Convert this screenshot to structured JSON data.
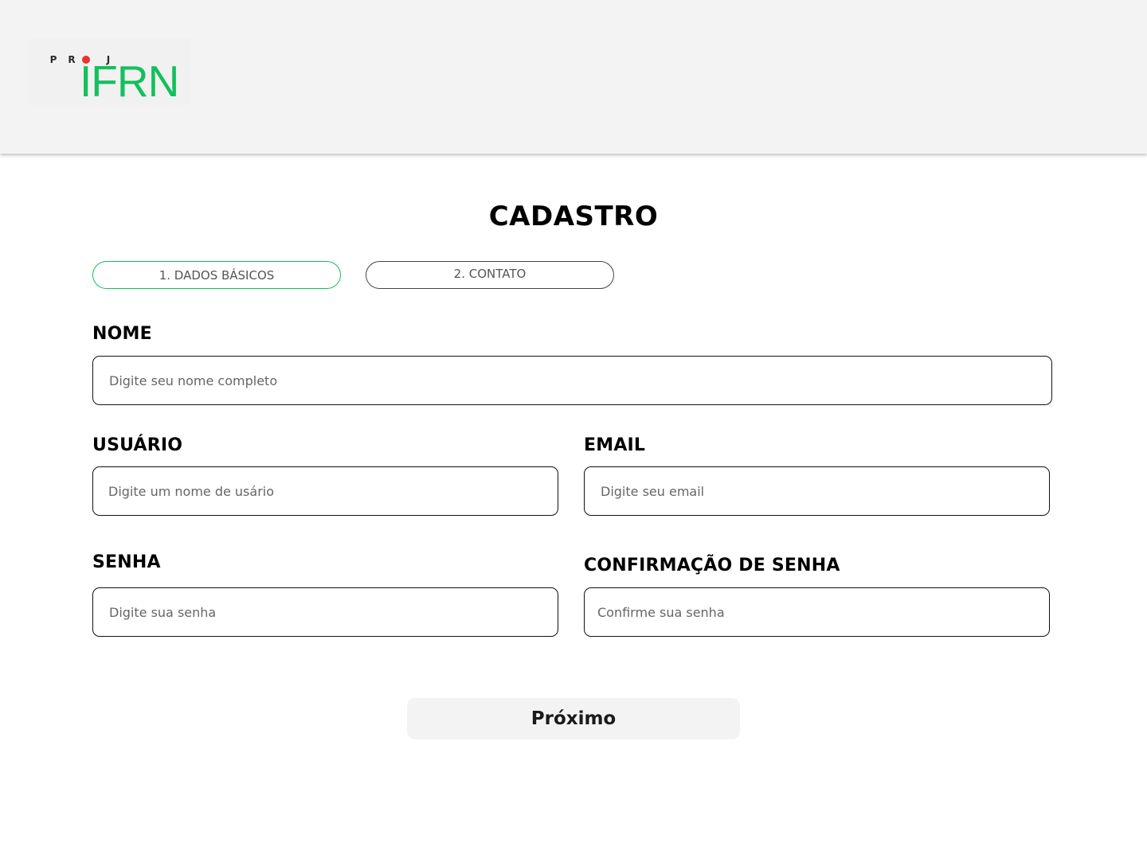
{
  "logo": {
    "proj_letters": [
      "P",
      "R",
      "O",
      "J"
    ],
    "name": "IFRN",
    "colors": {
      "green": "#12c05c",
      "dot_red": "#e8322e"
    }
  },
  "page": {
    "title": "CADASTRO"
  },
  "steps": [
    {
      "label": "1. DADOS BÁSICOS",
      "active": true
    },
    {
      "label": "2. CONTATO",
      "active": false
    }
  ],
  "form": {
    "nome": {
      "label": "NOME",
      "placeholder": "Digite seu nome completo",
      "value": ""
    },
    "usuario": {
      "label": "USUÁRIO",
      "placeholder": "Digite um nome de usário",
      "value": ""
    },
    "email": {
      "label": "EMAIL",
      "placeholder": "Digite seu email",
      "value": ""
    },
    "senha": {
      "label": "SENHA",
      "placeholder": "Digite sua senha",
      "value": ""
    },
    "confirmacao": {
      "label": "CONFIRMAÇÃO DE SENHA",
      "placeholder": "Confirme sua senha",
      "value": ""
    }
  },
  "actions": {
    "next_label": "Próximo"
  }
}
